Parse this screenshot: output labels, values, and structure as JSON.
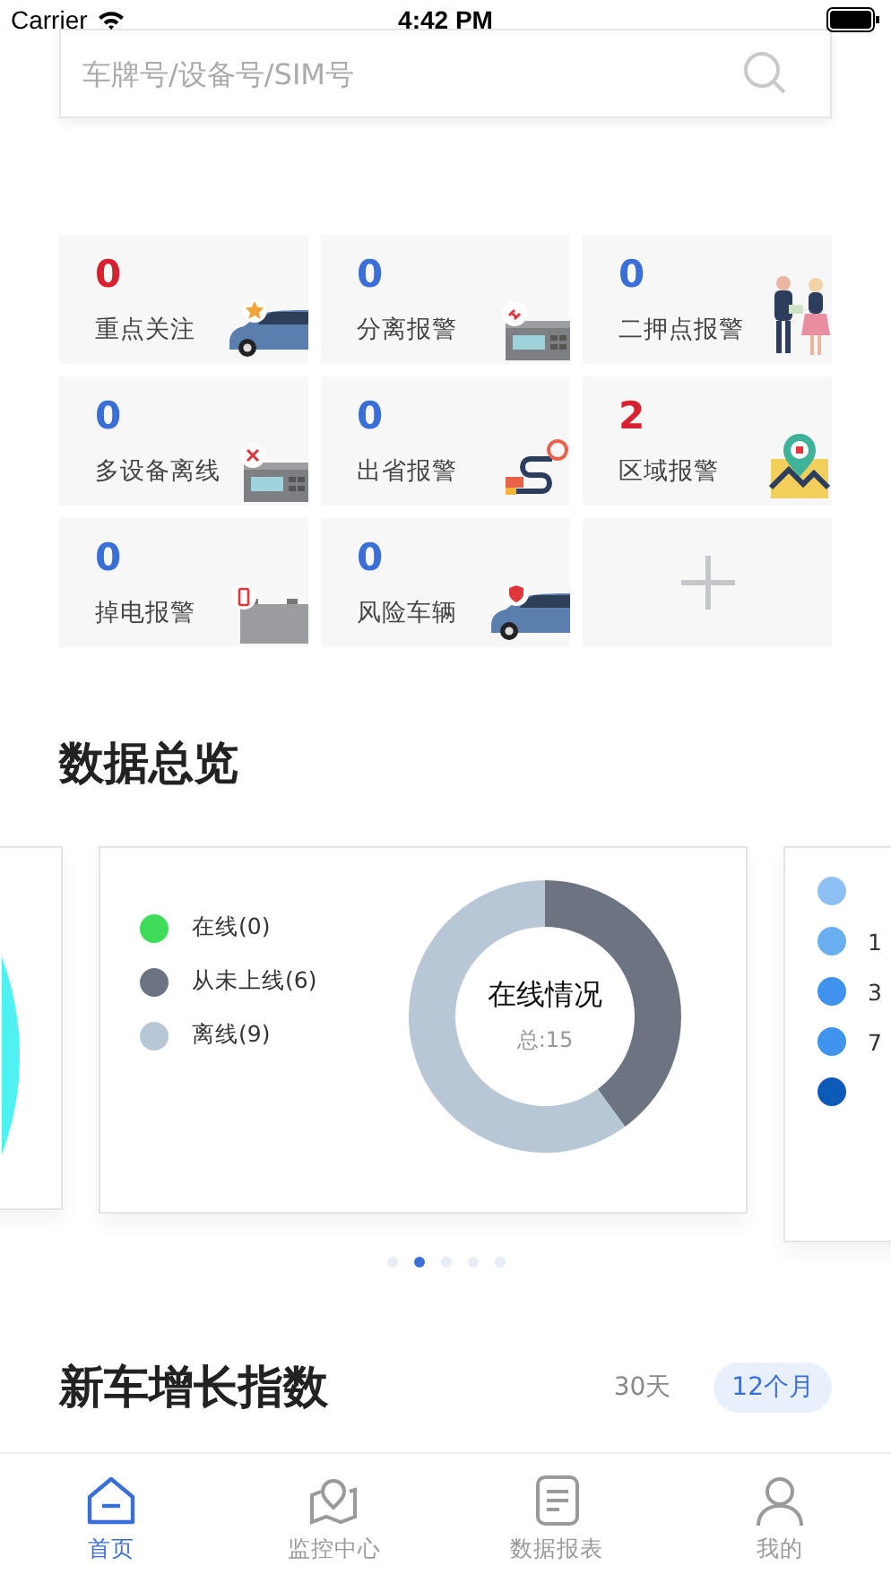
{
  "status_bar": {
    "carrier": "Carrier",
    "time": "4:42 PM"
  },
  "search": {
    "placeholder": "车牌号/设备号/SIM号"
  },
  "tiles": [
    {
      "kind": "stat",
      "count": "0",
      "label": "重点关注",
      "alert": true
    },
    {
      "kind": "stat",
      "count": "0",
      "label": "分离报警",
      "alert": false
    },
    {
      "kind": "stat",
      "count": "0",
      "label": "二押点报警",
      "alert": false
    },
    {
      "kind": "stat",
      "count": "0",
      "label": "多设备离线",
      "alert": false
    },
    {
      "kind": "stat",
      "count": "0",
      "label": "出省报警",
      "alert": false
    },
    {
      "kind": "stat",
      "count": "2",
      "label": "区域报警",
      "alert": true
    },
    {
      "kind": "stat",
      "count": "0",
      "label": "掉电报警",
      "alert": false
    },
    {
      "kind": "stat",
      "count": "0",
      "label": "风险车辆",
      "alert": false
    },
    {
      "kind": "add"
    }
  ],
  "overview": {
    "title": "数据总览",
    "online_card": {
      "center_title": "在线情况",
      "center_total": "总:15",
      "legend": [
        {
          "color": "#3fdc5a"
        },
        {
          "color": "#6b7480"
        },
        {
          "color": "#b8c7d6"
        }
      ],
      "chart_data": {
        "type": "donut",
        "categories": [
          "在线(0)",
          "从未上线(6)",
          "离线(9)"
        ],
        "values": [
          0,
          6,
          9
        ]
      }
    },
    "next_card": {
      "legend": [
        {
          "color": "#8fc0f5"
        },
        {
          "label": "1",
          "color": "#6aaef2"
        },
        {
          "label": "3",
          "color": "#3d93ee"
        },
        {
          "label": "7",
          "color": "#3f95ee"
        },
        {
          "color": "#0c5bb8"
        }
      ]
    },
    "pages": [
      {
        "selected": false
      },
      {
        "selected": true
      },
      {
        "selected": false
      },
      {
        "selected": false
      },
      {
        "selected": false
      }
    ]
  },
  "growth": {
    "title": "新车增长指数",
    "ranges": [
      {
        "label": "30天",
        "selected": false
      },
      {
        "label": "12个月",
        "selected": true
      }
    ]
  },
  "tabbar": [
    {
      "label": "首页",
      "selected": true
    },
    {
      "label": "监控中心",
      "selected": false
    },
    {
      "label": "数据报表",
      "selected": false
    },
    {
      "label": "我的",
      "selected": false
    }
  ]
}
